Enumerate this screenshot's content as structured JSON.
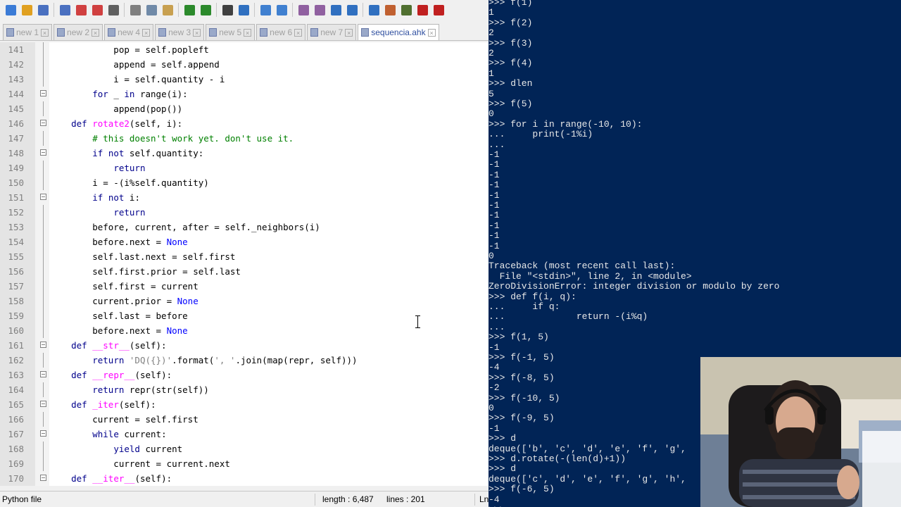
{
  "toolbar": {
    "icons": [
      "new-file-icon",
      "open-file-icon",
      "save-icon",
      "save-all-icon",
      "close-icon",
      "close-all-icon",
      "print-icon",
      "cut-icon",
      "copy-icon",
      "paste-icon",
      "undo-icon",
      "redo-icon",
      "find-icon",
      "replace-icon",
      "zoom-in-icon",
      "zoom-out-icon",
      "sync-vertical-icon",
      "sync-horizontal-icon",
      "word-wrap-icon",
      "show-all-chars-icon",
      "indent-guide-icon",
      "doc-map-icon",
      "function-list-icon",
      "macro-record-icon",
      "close-panel-icon"
    ]
  },
  "tabs": [
    {
      "label": "new 1",
      "icon": "blue"
    },
    {
      "label": "new 2",
      "icon": "blue"
    },
    {
      "label": "new 4",
      "icon": "blue"
    },
    {
      "label": "new 3",
      "icon": "blue"
    },
    {
      "label": "new 5",
      "icon": "blue"
    },
    {
      "label": "new 6",
      "icon": "blue"
    },
    {
      "label": "new 7",
      "icon": "blue"
    },
    {
      "label": "sequencia.ahk",
      "icon": "blue",
      "active": true
    }
  ],
  "editor": {
    "lines": [
      {
        "n": "141",
        "fold": "line",
        "code": "            pop = self.popleft"
      },
      {
        "n": "142",
        "fold": "line",
        "code": "            append = self.append"
      },
      {
        "n": "143",
        "fold": "line",
        "code": "            i = self.quantity - i"
      },
      {
        "n": "144",
        "fold": "box",
        "code": "        for _ in range(i):"
      },
      {
        "n": "145",
        "fold": "line",
        "code": "            append(pop())"
      },
      {
        "n": "146",
        "fold": "box",
        "code": "    def rotate2(self, i):"
      },
      {
        "n": "147",
        "fold": "line",
        "code": "        # this doesn't work yet. don't use it."
      },
      {
        "n": "148",
        "fold": "box",
        "code": "        if not self.quantity:"
      },
      {
        "n": "149",
        "fold": "line",
        "code": "            return"
      },
      {
        "n": "150",
        "fold": "line",
        "code": "        i = -(i%self.quantity)"
      },
      {
        "n": "151",
        "fold": "box",
        "code": "        if not i:"
      },
      {
        "n": "152",
        "fold": "line",
        "code": "            return"
      },
      {
        "n": "153",
        "fold": "line",
        "code": "        before, current, after = self._neighbors(i)"
      },
      {
        "n": "154",
        "fold": "line",
        "code": "        before.next = None"
      },
      {
        "n": "155",
        "fold": "line",
        "code": "        self.last.next = self.first"
      },
      {
        "n": "156",
        "fold": "line",
        "code": "        self.first.prior = self.last"
      },
      {
        "n": "157",
        "fold": "line",
        "code": "        self.first = current"
      },
      {
        "n": "158",
        "fold": "line",
        "code": "        current.prior = None"
      },
      {
        "n": "159",
        "fold": "line",
        "code": "        self.last = before"
      },
      {
        "n": "160",
        "fold": "line",
        "code": "        before.next = None"
      },
      {
        "n": "161",
        "fold": "box",
        "code": "    def __str__(self):"
      },
      {
        "n": "162",
        "fold": "line",
        "code": "        return 'DQ({})'.format(', '.join(map(repr, self)))"
      },
      {
        "n": "163",
        "fold": "box",
        "code": "    def __repr__(self):"
      },
      {
        "n": "164",
        "fold": "line",
        "code": "        return repr(str(self))"
      },
      {
        "n": "165",
        "fold": "box",
        "code": "    def _iter(self):"
      },
      {
        "n": "166",
        "fold": "line",
        "code": "        current = self.first"
      },
      {
        "n": "167",
        "fold": "box",
        "code": "        while current:"
      },
      {
        "n": "168",
        "fold": "line",
        "code": "            yield current"
      },
      {
        "n": "169",
        "fold": "line",
        "code": "            current = current.next"
      },
      {
        "n": "170",
        "fold": "box",
        "code": "    def __iter__(self):"
      }
    ]
  },
  "statusbar": {
    "file_type": "Python file",
    "length": "length : 6,487",
    "lines": "lines : 201",
    "position": "Ln"
  },
  "terminal": {
    "lines": [
      ">>> f(1)",
      "1",
      ">>> f(2)",
      "2",
      ">>> f(3)",
      "2",
      ">>> f(4)",
      "1",
      ">>> dlen",
      "5",
      ">>> f(5)",
      "0",
      ">>> for i in range(-10, 10):",
      "...     print(-1%i)",
      "...",
      "-1",
      "-1",
      "-1",
      "-1",
      "-1",
      "-1",
      "-1",
      "-1",
      "-1",
      "-1",
      "0",
      "Traceback (most recent call last):",
      "  File \"<stdin>\", line 2, in <module>",
      "ZeroDivisionError: integer division or modulo by zero",
      ">>> def f(i, q):",
      "...     if q:",
      "...             return -(i%q)",
      "...",
      ">>> f(1, 5)",
      "-1",
      ">>> f(-1, 5)",
      "-4",
      ">>> f(-8, 5)",
      "-2",
      ">>> f(-10, 5)",
      "0",
      ">>> f(-9, 5)",
      "-1",
      ">>> d",
      "deque(['b', 'c', 'd', 'e', 'f', 'g',",
      ">>> d.rotate(-(len(d)+1))",
      ">>> d",
      "deque(['c', 'd', 'e', 'f', 'g', 'h',",
      ">>> f(-6, 5)",
      "-4",
      ">>> "
    ]
  },
  "colors": {
    "terminal_bg": "#012456",
    "terminal_fg": "#e8e8e8",
    "keyword": "#00008b",
    "function_name": "#ff00ff",
    "comment": "#008000",
    "string": "#808080",
    "none_keyword": "#0000ff"
  },
  "webcam": {
    "icon": "webcam-overlay"
  }
}
